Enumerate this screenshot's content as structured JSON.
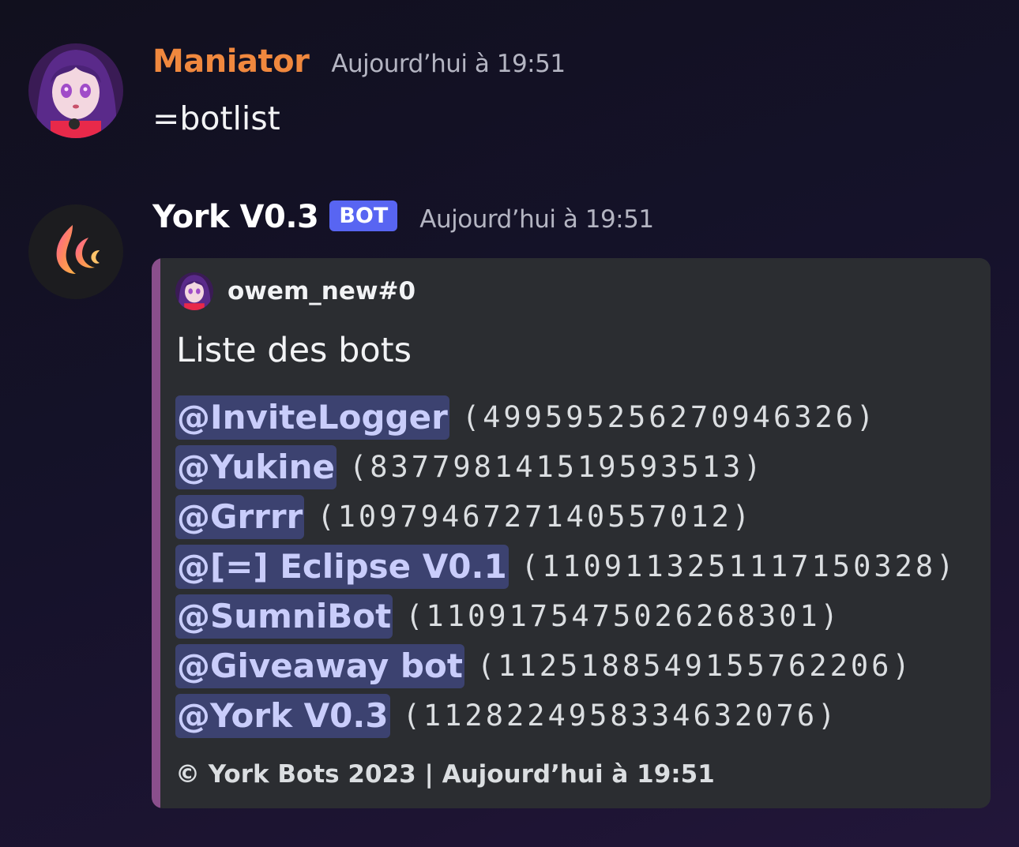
{
  "messages": [
    {
      "author": "Maniator",
      "author_color": "#f0883e",
      "timestamp": "Aujourd’hui à 19:51",
      "content": "=botlist"
    },
    {
      "author": "York V0.3",
      "badge": "BOT",
      "timestamp": "Aujourd’hui à 19:51",
      "embed": {
        "color": "#8a4f8c",
        "author_name": "owem_new#0",
        "title": "Liste des bots",
        "bots": [
          {
            "mention": "@InviteLogger",
            "id": "(499595256270946326)"
          },
          {
            "mention": "@Yukine",
            "id": "(837798141519593513)"
          },
          {
            "mention": "@Grrrr",
            "id": "(1097946727140557012)"
          },
          {
            "mention": "@[=] Eclipse V0.1",
            "id": "(1109113251117150328)"
          },
          {
            "mention": "@SumniBot",
            "id": "(1109175475026268301)"
          },
          {
            "mention": "@Giveaway bot",
            "id": "(1125188549155762206)"
          },
          {
            "mention": "@York V0.3",
            "id": "(1128224958334632076)"
          }
        ],
        "footer": "© York Bots 2023 | Aujourd’hui à 19:51"
      }
    }
  ]
}
